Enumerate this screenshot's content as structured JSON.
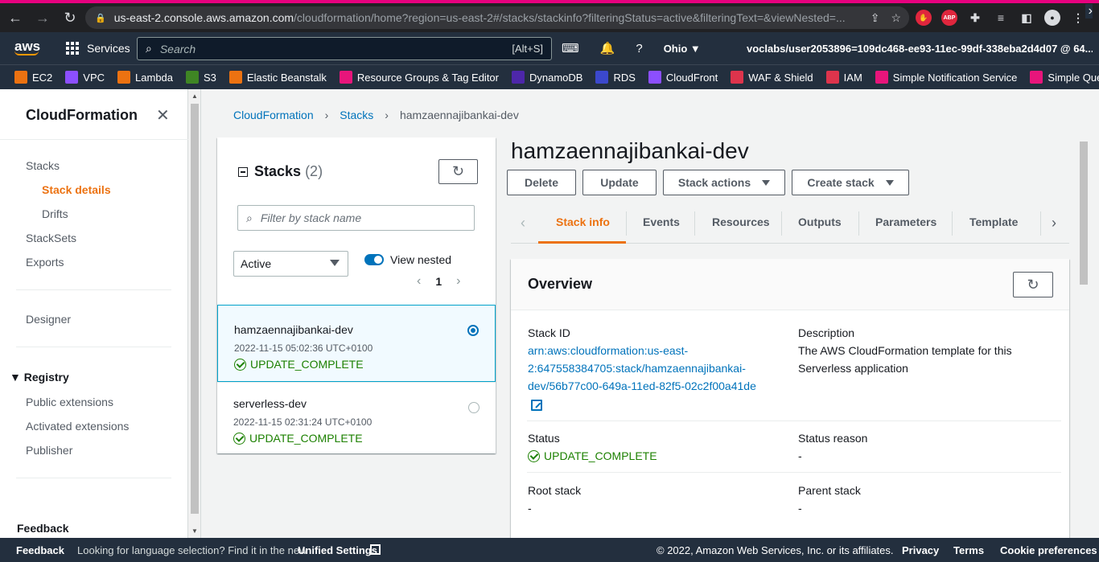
{
  "browser": {
    "url_host": "us-east-2.console.aws.amazon.com",
    "url_path": "/cloudformation/home?region=us-east-2#/stacks/stackinfo?filteringStatus=active&filteringText=&viewNested=..."
  },
  "aws_nav": {
    "logo": "aws",
    "services_label": "Services",
    "search_placeholder": "Search",
    "search_shortcut": "[Alt+S]",
    "region": "Ohio ▼",
    "account": "voclabs/user2053896=109dc468-ee93-11ec-99df-338eba2d4d07 @ 64... ▼"
  },
  "favorites": [
    {
      "label": "EC2",
      "color": "#ec7211"
    },
    {
      "label": "VPC",
      "color": "#8c4fff"
    },
    {
      "label": "Lambda",
      "color": "#ec7211"
    },
    {
      "label": "S3",
      "color": "#3f8624"
    },
    {
      "label": "Elastic Beanstalk",
      "color": "#ec7211"
    },
    {
      "label": "Resource Groups & Tag Editor",
      "color": "#e7157b"
    },
    {
      "label": "DynamoDB",
      "color": "#4d27aa"
    },
    {
      "label": "RDS",
      "color": "#3b48cc"
    },
    {
      "label": "CloudFront",
      "color": "#8c4fff"
    },
    {
      "label": "WAF & Shield",
      "color": "#dd344c"
    },
    {
      "label": "IAM",
      "color": "#dd344c"
    },
    {
      "label": "Simple Notification Service",
      "color": "#e7157b"
    },
    {
      "label": "Simple Queue Se",
      "color": "#e7157b"
    }
  ],
  "sidebar": {
    "title": "CloudFormation",
    "stacks": "Stacks",
    "stack_details": "Stack details",
    "drifts": "Drifts",
    "stacksets": "StackSets",
    "exports": "Exports",
    "designer": "Designer",
    "registry": "Registry",
    "public_extensions": "Public extensions",
    "activated_extensions": "Activated extensions",
    "publisher": "Publisher",
    "feedback": "Feedback"
  },
  "breadcrumb": {
    "root": "CloudFormation",
    "stacks": "Stacks",
    "current": "hamzaennajibankai-dev"
  },
  "stacks_panel": {
    "title": "Stacks",
    "count": "(2)",
    "filter_placeholder": "Filter by stack name",
    "status_filter": "Active",
    "view_nested_label": "View nested",
    "page": "1",
    "items": [
      {
        "name": "hamzaennajibankai-dev",
        "date": "2022-11-15 05:02:36 UTC+0100",
        "status": "UPDATE_COMPLETE"
      },
      {
        "name": "serverless-dev",
        "date": "2022-11-15 02:31:24 UTC+0100",
        "status": "UPDATE_COMPLETE"
      }
    ]
  },
  "detail": {
    "title": "hamzaennajibankai-dev",
    "buttons": {
      "delete": "Delete",
      "update": "Update",
      "stack_actions": "Stack actions",
      "create_stack": "Create stack"
    },
    "tabs": [
      "Stack info",
      "Events",
      "Resources",
      "Outputs",
      "Parameters",
      "Template"
    ],
    "overview": {
      "title": "Overview",
      "stack_id_label": "Stack ID",
      "stack_id_value": "arn:aws:cloudformation:us-east-2:647558384705:stack/hamzaennajibankai-dev/56b77c00-649a-11ed-82f5-02c2f00a41de",
      "description_label": "Description",
      "description_value": "The AWS CloudFormation template for this Serverless application",
      "status_label": "Status",
      "status_value": "UPDATE_COMPLETE",
      "status_reason_label": "Status reason",
      "status_reason_value": "-",
      "root_stack_label": "Root stack",
      "root_stack_value": "-",
      "parent_stack_label": "Parent stack",
      "parent_stack_value": "-"
    }
  },
  "footer": {
    "feedback": "Feedback",
    "language_prompt": "Looking for language selection? Find it in the new",
    "unified_settings": "Unified Settings",
    "copyright": "© 2022, Amazon Web Services, Inc. or its affiliates.",
    "privacy": "Privacy",
    "terms": "Terms",
    "cookie": "Cookie preferences"
  }
}
